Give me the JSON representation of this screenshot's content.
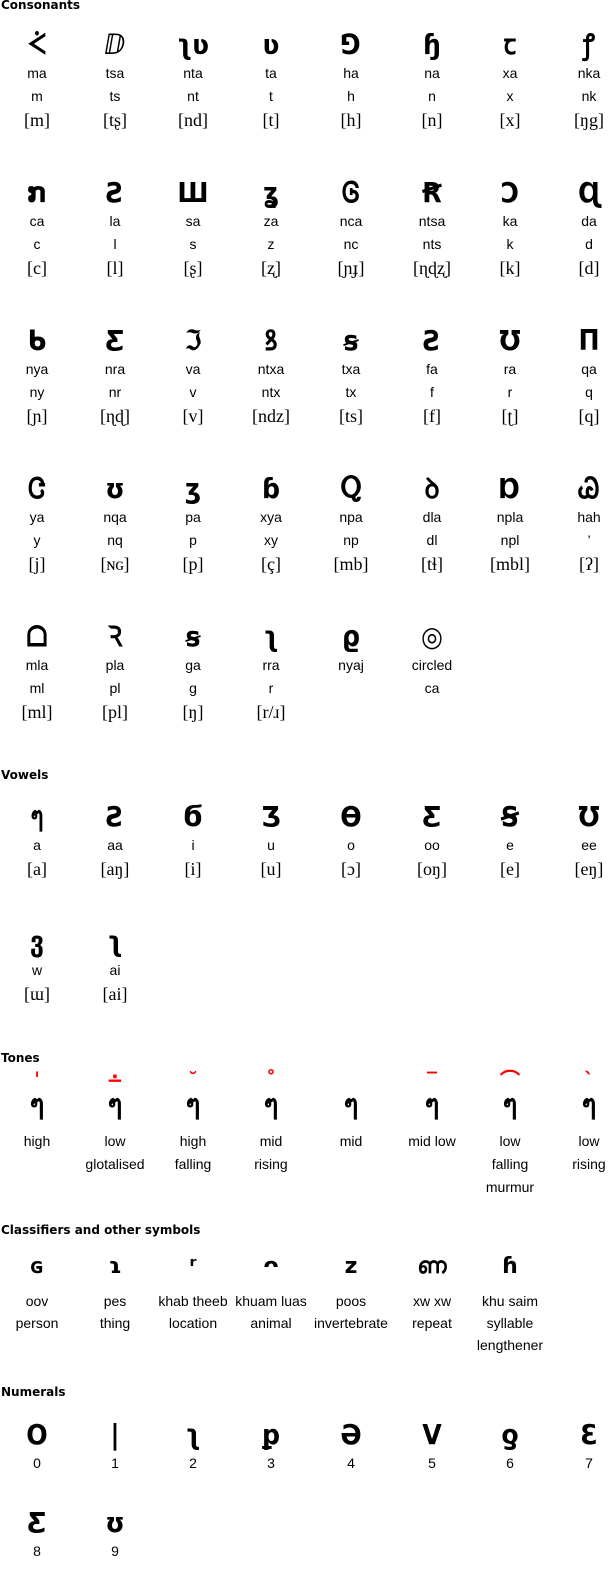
{
  "consonants": {
    "title": "Consonants",
    "items": [
      {
        "glyph": "ᢵ",
        "glyph_alt": "ᥑ",
        "name": "ma",
        "latin": "m",
        "ipa": "[m]"
      },
      {
        "glyph": "ⅅ",
        "name": "tsa",
        "latin": "ts",
        "ipa": "[tʂ]"
      },
      {
        "glyph": "ʅʋ",
        "name": "nta",
        "latin": "nt",
        "ipa": "[nd]"
      },
      {
        "glyph": "ʋ",
        "name": "ta",
        "latin": "t",
        "ipa": "[t]"
      },
      {
        "glyph": "⅁",
        "name": "ha",
        "latin": "h",
        "ipa": "[h]"
      },
      {
        "glyph": "ɧ",
        "name": "na",
        "latin": "n",
        "ipa": "[n]"
      },
      {
        "glyph": "ꞇ",
        "name": "xa",
        "latin": "x",
        "ipa": "[x]"
      },
      {
        "glyph": "ꝭ",
        "name": "nka",
        "latin": "nk",
        "ipa": "[ŋg]"
      },
      {
        "glyph": "ກ",
        "name": "ca",
        "latin": "c",
        "ipa": "[c]"
      },
      {
        "glyph": "Ƨ",
        "name": "la",
        "latin": "l",
        "ipa": "[l]"
      },
      {
        "glyph": "Ш",
        "name": "sa",
        "latin": "s",
        "ipa": "[ʂ]"
      },
      {
        "glyph": "ʓ",
        "name": "za",
        "latin": "z",
        "ipa": "[ʐ]"
      },
      {
        "glyph": "Ꮆ",
        "name": "nca",
        "latin": "nc",
        "ipa": "[ɲɟ]"
      },
      {
        "glyph": "Ꞧ",
        "name": "ntsa",
        "latin": "nts",
        "ipa": "[ɳɖʐ]"
      },
      {
        "glyph": "Ɔ",
        "name": "ka",
        "latin": "k",
        "ipa": "[k]"
      },
      {
        "glyph": "Ɋ",
        "name": "da",
        "latin": "d",
        "ipa": "[d]"
      },
      {
        "glyph": "ᑲ",
        "name": "nya",
        "latin": "ny",
        "ipa": "[ɲ]"
      },
      {
        "glyph": "Ƹ",
        "name": "nra",
        "latin": "nr",
        "ipa": "[ɳɖ]"
      },
      {
        "glyph": "ℑ",
        "name": "va",
        "latin": "v",
        "ipa": "[v]"
      },
      {
        "glyph": "ꝸ",
        "name": "ntxa",
        "latin": "ntx",
        "ipa": "[ndz]"
      },
      {
        "glyph": "ꞩ",
        "name": "txa",
        "latin": "tx",
        "ipa": "[ts]"
      },
      {
        "glyph": "Ꙅ",
        "name": "fa",
        "latin": "f",
        "ipa": "[f]"
      },
      {
        "glyph": "Ʊ",
        "name": "ra",
        "latin": "r",
        "ipa": "[ʈ]"
      },
      {
        "glyph": "Π",
        "name": "qa",
        "latin": "q",
        "ipa": "[q]"
      },
      {
        "glyph": "Ꮳ",
        "name": "ya",
        "latin": "y",
        "ipa": "[j]"
      },
      {
        "glyph": "ʊ",
        "name": "nqa",
        "latin": "nq",
        "ipa": "[ɴɢ]"
      },
      {
        "glyph": "ʒ",
        "name": "pa",
        "latin": "p",
        "ipa": "[p]"
      },
      {
        "glyph": "ɓ",
        "name": "xya",
        "latin": "xy",
        "ipa": "[ç]"
      },
      {
        "glyph": "Ⴍ",
        "name": "npa",
        "latin": "np",
        "ipa": "[mb]"
      },
      {
        "glyph": "ꝺ",
        "name": "dla",
        "latin": "dl",
        "ipa": "[tɬ]"
      },
      {
        "glyph": "Ɒ",
        "name": "npla",
        "latin": "npl",
        "ipa": "[mbl]"
      },
      {
        "glyph": "Ꮚ",
        "name": "hah",
        "latin": "’",
        "ipa": "[ʔ]"
      },
      {
        "glyph": "ᗝ",
        "name": "mla",
        "latin": "ml",
        "ipa": "[ml]"
      },
      {
        "glyph": "Ꝛ",
        "name": "pla",
        "latin": "pl",
        "ipa": "[pl]"
      },
      {
        "glyph": "ꞩ",
        "name": "ga",
        "latin": "g",
        "ipa": "[ŋ]"
      },
      {
        "glyph": "ʅ",
        "name": "rra",
        "latin": "r",
        "ipa": "[r/ɹ]"
      },
      {
        "glyph": "ϱ",
        "name": "nyaj",
        "latin": "",
        "ipa": ""
      },
      {
        "glyph": "◎",
        "name": "circled",
        "latin": "ca",
        "ipa": ""
      }
    ]
  },
  "vowels": {
    "title": "Vowels",
    "items": [
      {
        "glyph": "ๆ",
        "name": "a",
        "ipa": "[a]"
      },
      {
        "glyph": "Ƨ",
        "name": "aa",
        "ipa": "[aŋ]"
      },
      {
        "glyph": "Ϭ",
        "name": "i",
        "ipa": "[i]"
      },
      {
        "glyph": "Ʒ",
        "name": "u",
        "ipa": "[u]"
      },
      {
        "glyph": "Ѳ",
        "name": "o",
        "ipa": "[ɔ]"
      },
      {
        "glyph": "Ƹ",
        "name": "oo",
        "ipa": "[oŋ]"
      },
      {
        "glyph": "Ꞩ",
        "name": "e",
        "ipa": "[e]"
      },
      {
        "glyph": "Ʊ",
        "name": "ee",
        "ipa": "[eŋ]"
      },
      {
        "glyph": "ვ",
        "name": "w",
        "ipa": "[ɯ]"
      },
      {
        "glyph": "ʅ",
        "name": "ai",
        "ipa": "[ai]"
      }
    ]
  },
  "tones": {
    "title": "Tones",
    "base_glyph": "ๆ",
    "mark_color": "#ff0000",
    "items": [
      {
        "mark": "ˈ",
        "label_lines": [
          "high"
        ]
      },
      {
        "mark": "∸",
        "label_lines": [
          "low",
          "glotalised"
        ]
      },
      {
        "mark": "˘",
        "label_lines": [
          "high",
          "falling"
        ]
      },
      {
        "mark": "˚",
        "label_lines": [
          "mid",
          "rising"
        ]
      },
      {
        "mark": "",
        "label_lines": [
          "mid"
        ]
      },
      {
        "mark": "‾",
        "label_lines": [
          "mid low"
        ]
      },
      {
        "mark": "⌒",
        "label_lines": [
          "low",
          "falling",
          "murmur"
        ]
      },
      {
        "mark": "ˋ",
        "label_lines": [
          "low",
          "rising"
        ]
      }
    ]
  },
  "classifiers": {
    "title": "Classifiers and other symbols",
    "items": [
      {
        "glyph": "ɢ",
        "label_lines": [
          "oov",
          "person"
        ]
      },
      {
        "glyph": "ɿ",
        "label_lines": [
          "pes",
          "thing"
        ]
      },
      {
        "glyph": "ʳ",
        "label_lines": [
          "khab theeb",
          "location"
        ]
      },
      {
        "glyph": "ᴖ",
        "label_lines": [
          "khuam luas",
          "animal"
        ]
      },
      {
        "glyph": "ᴢ",
        "label_lines": [
          "poos",
          "invertebrate"
        ]
      },
      {
        "glyph": "ണ",
        "label_lines": [
          "xw xw",
          "repeat"
        ]
      },
      {
        "glyph": "ɦ",
        "label_lines": [
          "khu saim",
          "syllable",
          "lengthener"
        ]
      }
    ]
  },
  "numerals": {
    "title": "Numerals",
    "items": [
      {
        "glyph": "O",
        "value": "0"
      },
      {
        "glyph": "|",
        "value": "1"
      },
      {
        "glyph": "ʅ",
        "value": "2"
      },
      {
        "glyph": "ꝑ",
        "value": "3"
      },
      {
        "glyph": "Ə",
        "value": "4"
      },
      {
        "glyph": "V",
        "value": "5"
      },
      {
        "glyph": "ƍ",
        "value": "6"
      },
      {
        "glyph": "Ɛ",
        "value": "7"
      },
      {
        "glyph": "Ƹ",
        "value": "8"
      },
      {
        "glyph": "ʊ",
        "value": "9"
      }
    ]
  }
}
